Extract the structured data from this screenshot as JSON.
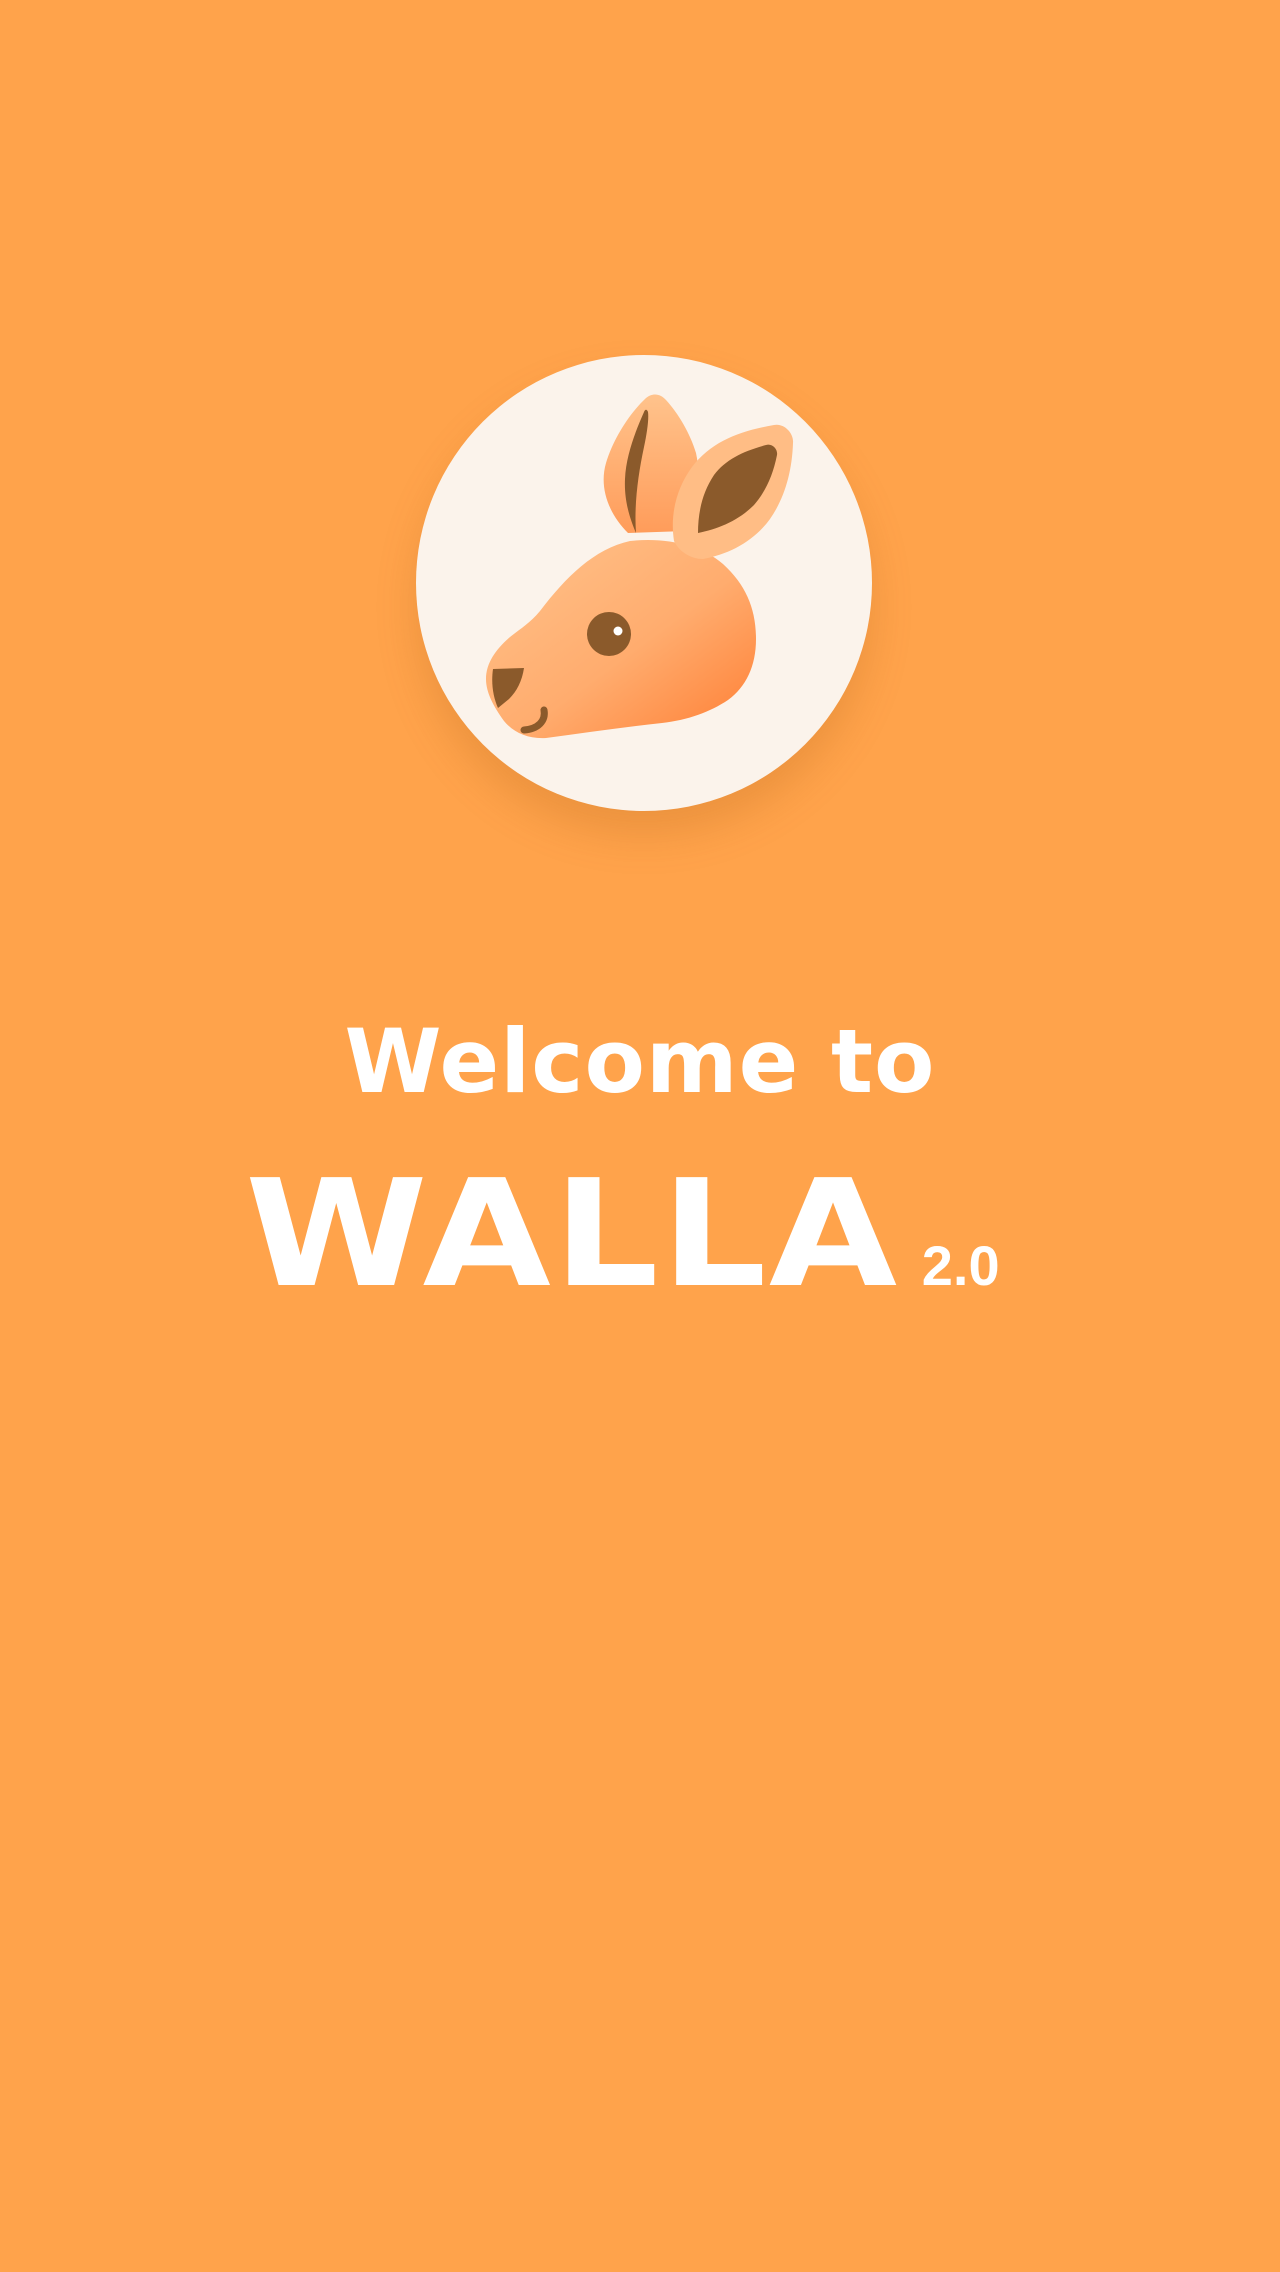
{
  "app": {
    "welcome_text": "Welcome to",
    "brand_name": "WALLA",
    "version": "2.0"
  },
  "logo": {
    "icon": "kangaroo-icon"
  },
  "colors": {
    "background": "#FFA34B",
    "logo_circle": "#FBF3EB",
    "text": "#FFFFFF",
    "accent_dark": "#8B5A2B"
  }
}
